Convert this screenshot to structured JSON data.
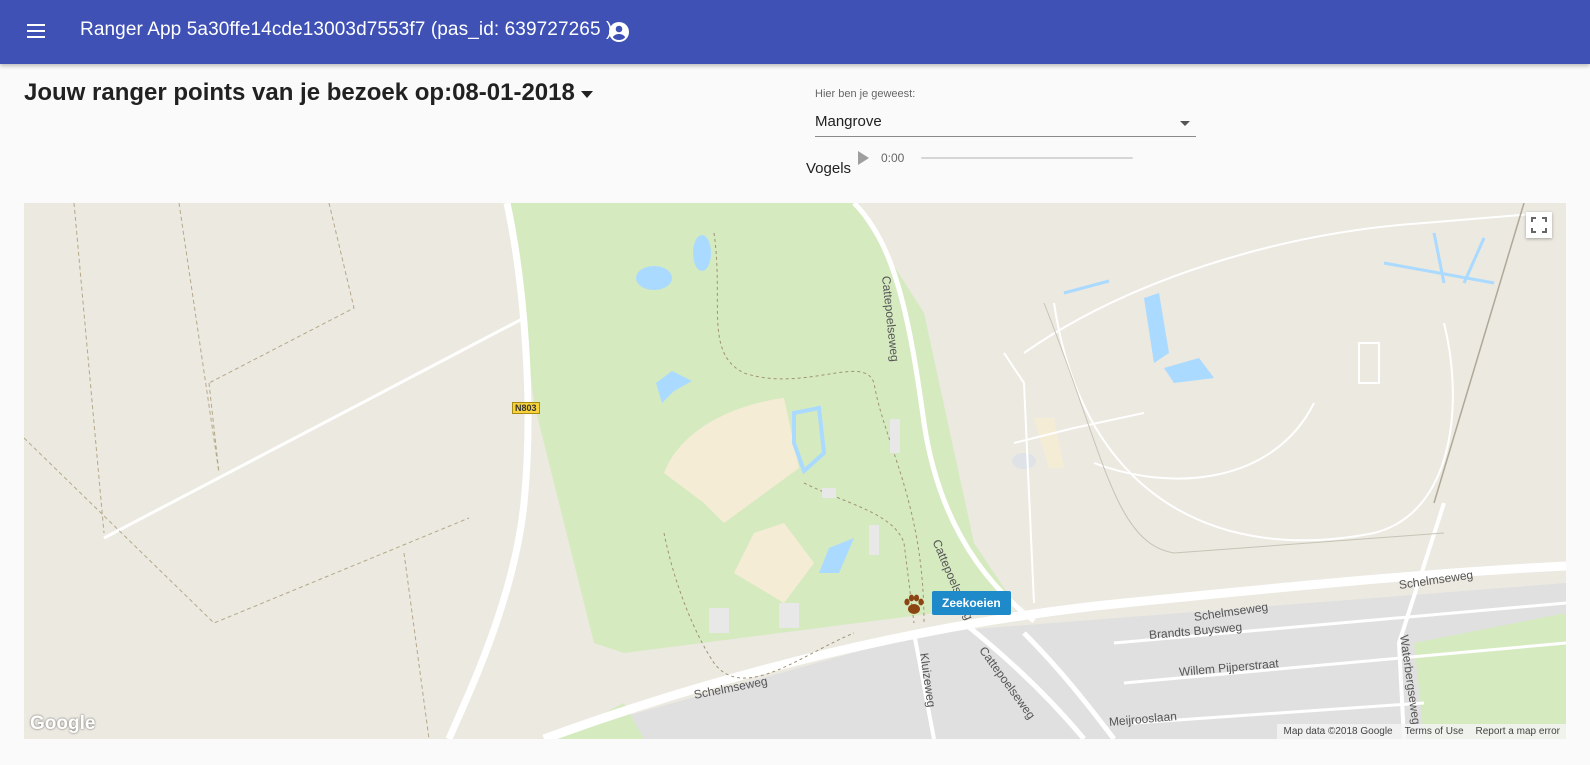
{
  "appbar": {
    "title": "Ranger App 5a30ffe14cde13003d7553f7 (pas_id: 639727265 )",
    "menu_icon": "menu-icon",
    "account_icon": "account-circle-icon",
    "color": "#3f51b5"
  },
  "visit": {
    "title": "Jouw ranger points van je bezoek op:08-01-2018"
  },
  "location_select": {
    "label": "Hier ben je geweest:",
    "value": "Mangrove"
  },
  "audio": {
    "label": "Vogels",
    "time": "0:00"
  },
  "map": {
    "marker_label": "Zeekoeien",
    "marker_icon": "paw-icon",
    "road_labels": {
      "cattepoelseweg_1": "Cattepoelseweg",
      "cattepoelseweg_2": "Cattepoelseweg",
      "cattepoelseweg_3": "Cattepoelseweg",
      "schelmseweg_1": "Schelmseweg",
      "schelmseweg_2": "Schelmseweg",
      "schelmseweg_3": "Schelmseweg",
      "brandts_buysweg": "Brandts Buysweg",
      "willem_pijperstraat": "Willem Pijperstraat",
      "kluizeweg": "Kluizeweg",
      "waterbergseweg": "Waterbergseweg",
      "meijrooslaan": "Meijrooslaan"
    },
    "shield_label": "N803",
    "google_logo": "Google",
    "footer": {
      "data": "Map data ©2018 Google",
      "terms": "Terms of Use",
      "report": "Report a map error"
    },
    "colors": {
      "park": "#d6eac0",
      "water": "#aadaff",
      "sand": "#f5ecd6",
      "urban": "#e0e0e0",
      "land": "#ebe9e0",
      "marker": "#1f8ac9"
    }
  }
}
